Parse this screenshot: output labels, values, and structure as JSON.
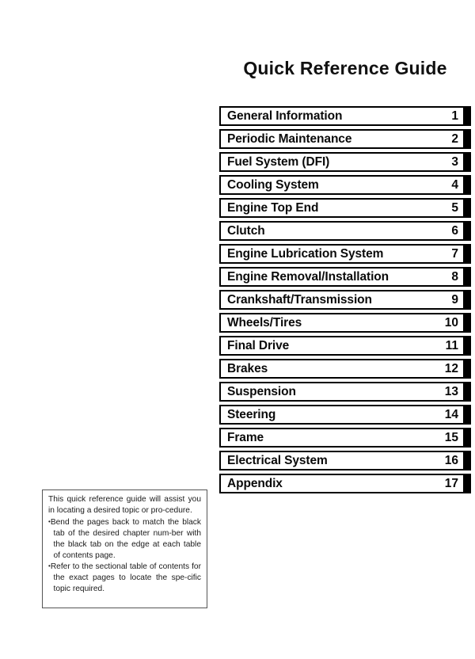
{
  "page": {
    "title": "Quick Reference Guide"
  },
  "chapters": [
    {
      "label": "General Information",
      "number": "1"
    },
    {
      "label": "Periodic Maintenance",
      "number": "2"
    },
    {
      "label": "Fuel System (DFI)",
      "number": "3"
    },
    {
      "label": "Cooling System",
      "number": "4"
    },
    {
      "label": "Engine Top End",
      "number": "5"
    },
    {
      "label": "Clutch",
      "number": "6"
    },
    {
      "label": "Engine Lubrication System",
      "number": "7"
    },
    {
      "label": "Engine Removal/Installation",
      "number": "8"
    },
    {
      "label": "Crankshaft/Transmission",
      "number": "9"
    },
    {
      "label": "Wheels/Tires",
      "number": "10"
    },
    {
      "label": "Final Drive",
      "number": "11"
    },
    {
      "label": "Brakes",
      "number": "12"
    },
    {
      "label": "Suspension",
      "number": "13"
    },
    {
      "label": "Steering",
      "number": "14"
    },
    {
      "label": "Frame",
      "number": "15"
    },
    {
      "label": "Electrical System",
      "number": "16"
    },
    {
      "label": "Appendix",
      "number": "17"
    }
  ],
  "note": {
    "intro": "This quick reference guide will assist you in locating a desired topic or pro-cedure.",
    "bullets": [
      "Bend the pages back to match the black tab of the desired chapter num-ber with the black tab on the edge at each table of contents page.",
      "Refer to the sectional table of contents for the exact pages to locate the spe-cific topic required."
    ]
  },
  "colors": {
    "ink": "#000000",
    "tab": "#000000",
    "note_border": "#555555",
    "paper": "#ffffff"
  }
}
